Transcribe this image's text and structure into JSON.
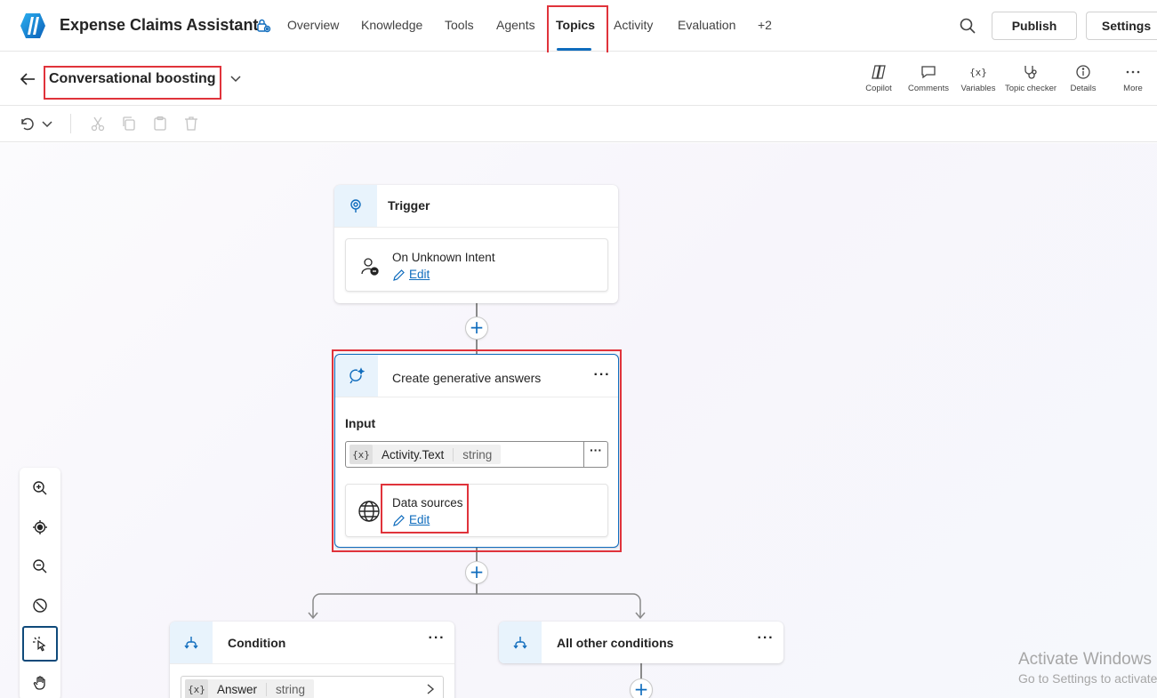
{
  "app": {
    "title": "Expense Claims Assistant",
    "accent": "#0f6cbd",
    "highlight_color": "#e0333b"
  },
  "nav": {
    "tabs": [
      {
        "label": "Overview",
        "active": false
      },
      {
        "label": "Knowledge",
        "active": false
      },
      {
        "label": "Tools",
        "active": false
      },
      {
        "label": "Agents",
        "active": false
      },
      {
        "label": "Topics",
        "active": true
      },
      {
        "label": "Activity",
        "active": false
      },
      {
        "label": "Evaluation",
        "active": false
      },
      {
        "label": "+2",
        "active": false
      }
    ],
    "publish_label": "Publish",
    "settings_label": "Settings"
  },
  "topic": {
    "title": "Conversational boosting",
    "tools": [
      {
        "label": "Copilot",
        "icon": "copilot-icon"
      },
      {
        "label": "Comments",
        "icon": "comment-icon"
      },
      {
        "label": "Variables",
        "icon": "variable-icon"
      },
      {
        "label": "Topic checker",
        "icon": "stethoscope-icon"
      },
      {
        "label": "Details",
        "icon": "info-icon"
      },
      {
        "label": "More",
        "icon": "more-icon"
      }
    ]
  },
  "canvas": {
    "trigger": {
      "title": "Trigger",
      "card_title": "On Unknown Intent",
      "edit_label": "Edit"
    },
    "gen_answers": {
      "title": "Create generative answers",
      "input_label": "Input",
      "variable": {
        "badge": "{x}",
        "name": "Activity.Text",
        "type": "string"
      },
      "data_sources_title": "Data sources",
      "edit_label": "Edit"
    },
    "condition": {
      "title": "Condition",
      "variable": {
        "badge": "{x}",
        "name": "Answer",
        "type": "string"
      }
    },
    "other_conditions": {
      "title": "All other conditions"
    },
    "more_glyph": "···",
    "add_glyph": "+"
  },
  "watermark": {
    "line1": "Activate Windows",
    "line2": "Go to Settings to activate Windows."
  }
}
